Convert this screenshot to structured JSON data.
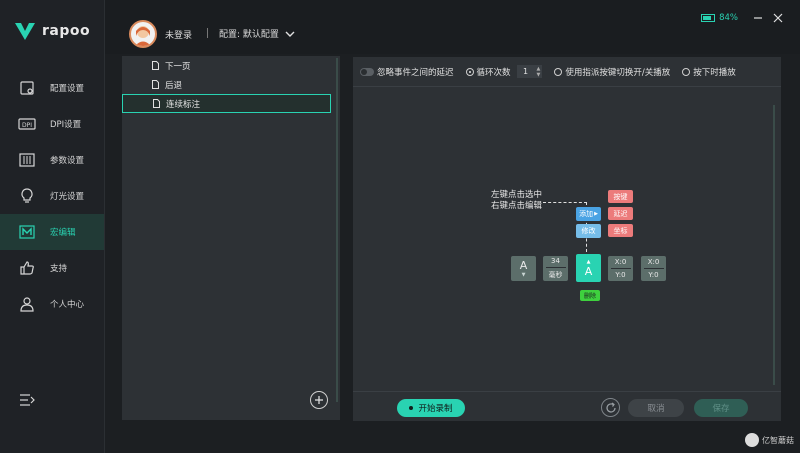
{
  "brand": {
    "logo_text": "rapoo"
  },
  "sidebar": {
    "items": [
      {
        "label": "配置设置",
        "icon": "config-icon"
      },
      {
        "label": "DPI设置",
        "icon": "dpi-icon"
      },
      {
        "label": "参数设置",
        "icon": "params-icon"
      },
      {
        "label": "灯光设置",
        "icon": "light-icon"
      },
      {
        "label": "宏编辑",
        "icon": "macro-icon",
        "active": true
      },
      {
        "label": "支持",
        "icon": "support-icon"
      },
      {
        "label": "个人中心",
        "icon": "user-icon"
      }
    ]
  },
  "header": {
    "user_name": "未登录",
    "config_label": "配置: 默认配置",
    "battery": {
      "percent_text": "84%",
      "level": 0.84
    }
  },
  "macro_list": {
    "items": [
      {
        "label": "下一页"
      },
      {
        "label": "后退"
      },
      {
        "label": "连续标注",
        "selected": true
      }
    ]
  },
  "toolbar": {
    "ignore_delay_label": "忽略事件之间的延迟",
    "loop_label": "循环次数",
    "loop_count": "1",
    "toggle_label": "使用指派按键切换开/关播放",
    "hold_label": "按下时播放"
  },
  "canvas": {
    "hint_line1": "左键点击选中",
    "hint_line2": "右键点击编辑",
    "add_label": "添加",
    "edit_label": "修改",
    "key_label": "按键",
    "delay_label": "延迟",
    "coord_label": "坐标",
    "delete_label": "删除",
    "events": [
      {
        "type": "key-down",
        "key": "A"
      },
      {
        "type": "delay",
        "value": "34",
        "unit": "毫秒"
      },
      {
        "type": "key-up",
        "key": "A"
      },
      {
        "type": "coord",
        "x": "X:0",
        "y": "Y:0"
      },
      {
        "type": "coord",
        "x": "X:0",
        "y": "Y:0"
      }
    ]
  },
  "footer": {
    "record_label": "开始录制",
    "cancel_label": "取消",
    "save_label": "保存"
  },
  "watermark": {
    "text": "亿智蘑菇"
  },
  "colors": {
    "accent": "#29d3b2",
    "chip_blue": "#4aa3e4",
    "chip_red": "#ec7b7b",
    "delete_green": "#3ed13e"
  }
}
